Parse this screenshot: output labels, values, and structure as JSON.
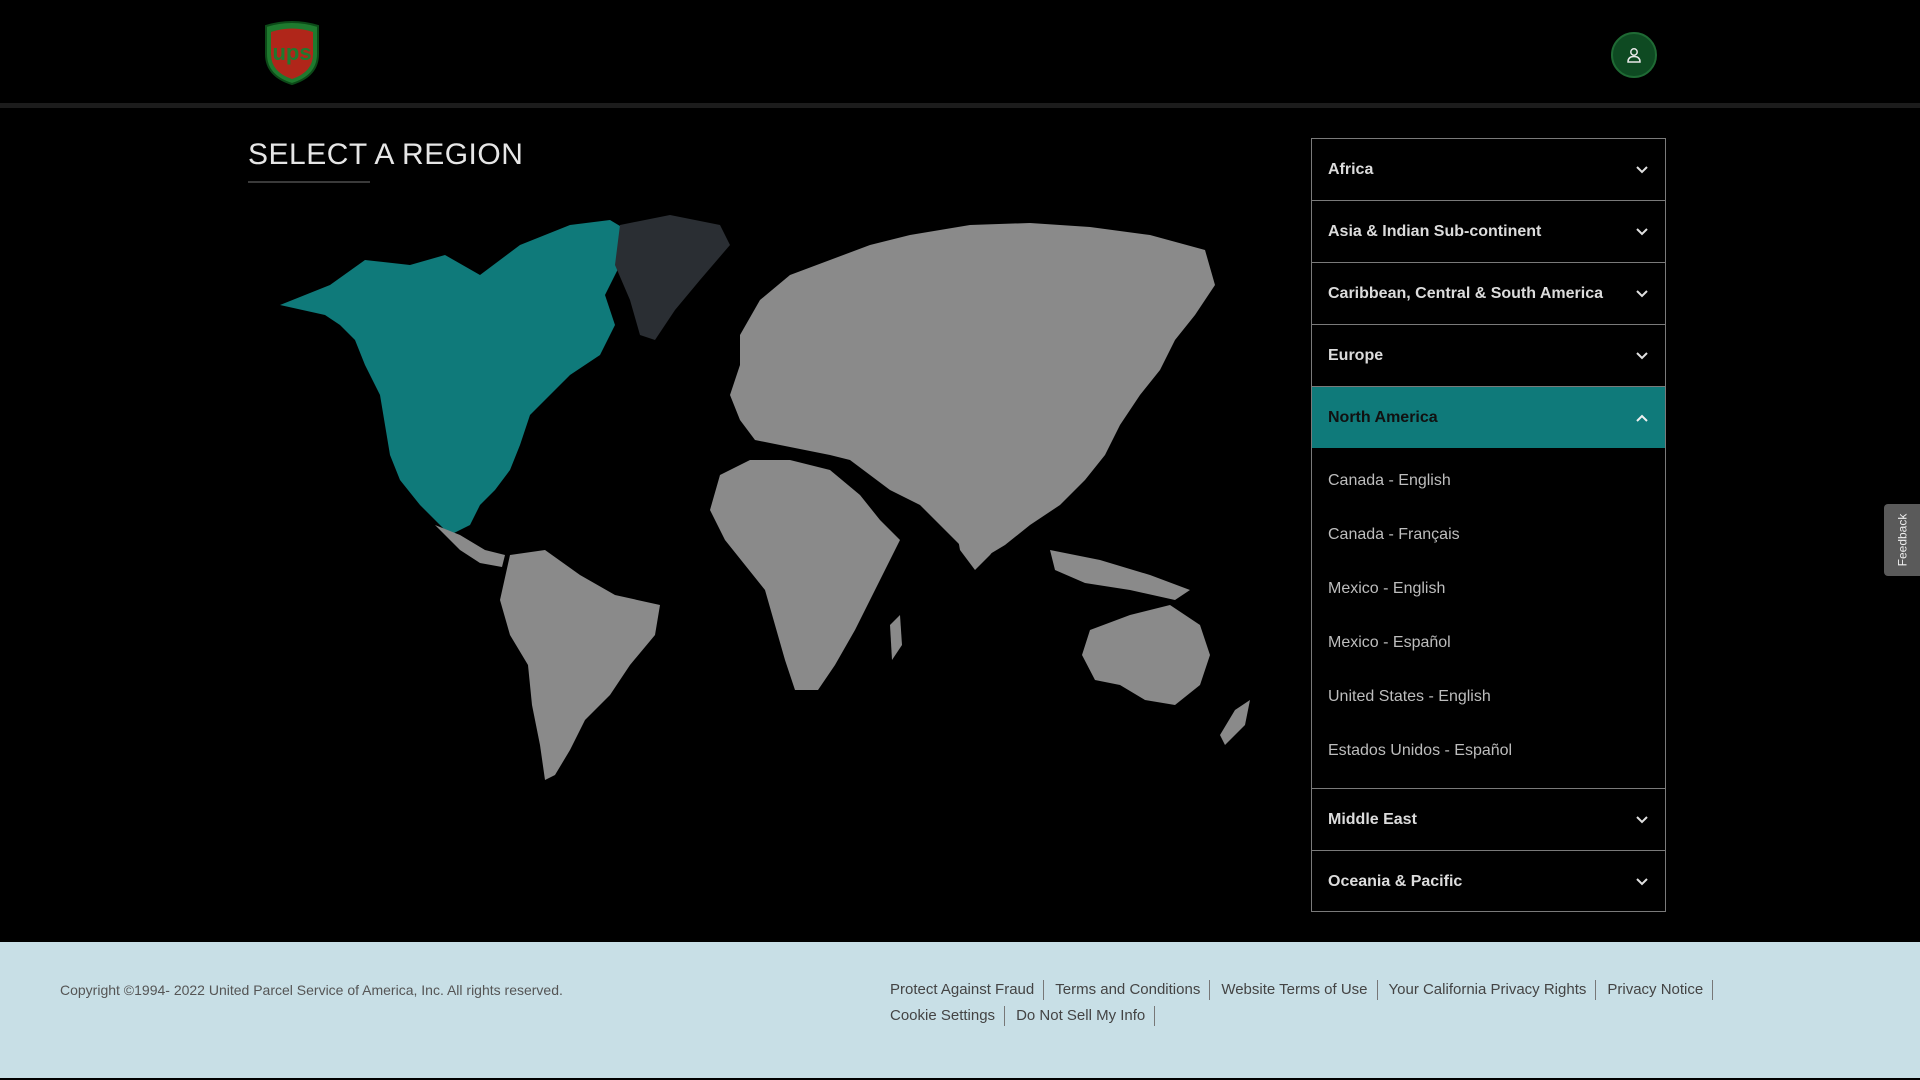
{
  "header": {
    "logo_text": "ups",
    "user_icon": "user-icon"
  },
  "page": {
    "title": "SELECT A REGION"
  },
  "regions": [
    {
      "label": "Africa",
      "expanded": false
    },
    {
      "label": "Asia & Indian Sub-continent",
      "expanded": false
    },
    {
      "label": "Caribbean, Central & South America",
      "expanded": false
    },
    {
      "label": "Europe",
      "expanded": false
    },
    {
      "label": "North America",
      "expanded": true
    },
    {
      "label": "Middle East",
      "expanded": false
    },
    {
      "label": "Oceania & Pacific",
      "expanded": false
    }
  ],
  "north_america_items": [
    "Canada - English",
    "Canada - Français",
    "Mexico - English",
    "Mexico - Español",
    "United States - English",
    "Estados Unidos - Español"
  ],
  "feedback": {
    "label": "Feedback"
  },
  "footer": {
    "copyright": "Copyright ©1994- 2022  United Parcel Service of America, Inc. All rights reserved.",
    "links": [
      "Protect Against Fraud",
      "Terms and Conditions",
      "Website Terms of Use",
      "Your California Privacy Rights",
      "Privacy Notice",
      "Cookie Settings",
      "Do Not Sell My Info"
    ]
  },
  "colors": {
    "accent_teal": "#0f7a7a",
    "map_gray": "#8a8a8a",
    "greenland": "#2a2e33",
    "footer_bg": "#c8dfe6",
    "ups_brown": "#8a1c12",
    "ups_gold": "#2a8a3a"
  }
}
